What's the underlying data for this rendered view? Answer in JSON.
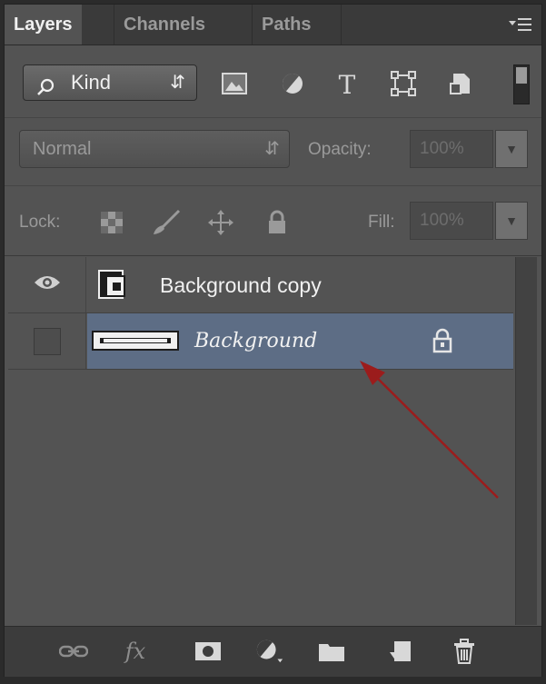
{
  "tabs": [
    {
      "label": "Layers",
      "active": true
    },
    {
      "label": "Channels",
      "active": false
    },
    {
      "label": "Paths",
      "active": false
    }
  ],
  "panel_menu_icon": "panel-menu-icon",
  "filter": {
    "kind_label": "Kind",
    "icons": [
      "pixel-layer-filter-icon",
      "adjustment-layer-filter-icon",
      "type-layer-filter-icon",
      "shape-layer-filter-icon",
      "smart-object-filter-icon"
    ]
  },
  "blend": {
    "mode": "Normal",
    "opacity_label": "Opacity:",
    "opacity_value": "100%"
  },
  "lock": {
    "label": "Lock:",
    "icons": [
      "lock-transparent-pixels-icon",
      "lock-image-pixels-icon",
      "lock-position-icon",
      "lock-all-icon"
    ],
    "fill_label": "Fill:",
    "fill_value": "100%"
  },
  "layers": [
    {
      "name": "Background copy",
      "visible": true,
      "selected": false,
      "locked": false
    },
    {
      "name": "Background",
      "visible": false,
      "selected": true,
      "locked": true
    }
  ],
  "bottom_bar": [
    "link-layers-icon",
    "fx-icon",
    "add-mask-icon",
    "new-adjustment-layer-icon",
    "new-group-icon",
    "new-layer-icon",
    "delete-layer-icon"
  ],
  "bottom_fx_label": "fx",
  "colors": {
    "panel_bg": "#535353",
    "selected_layer": "#5d6d85",
    "annotation_arrow": "#9b1c1c"
  }
}
